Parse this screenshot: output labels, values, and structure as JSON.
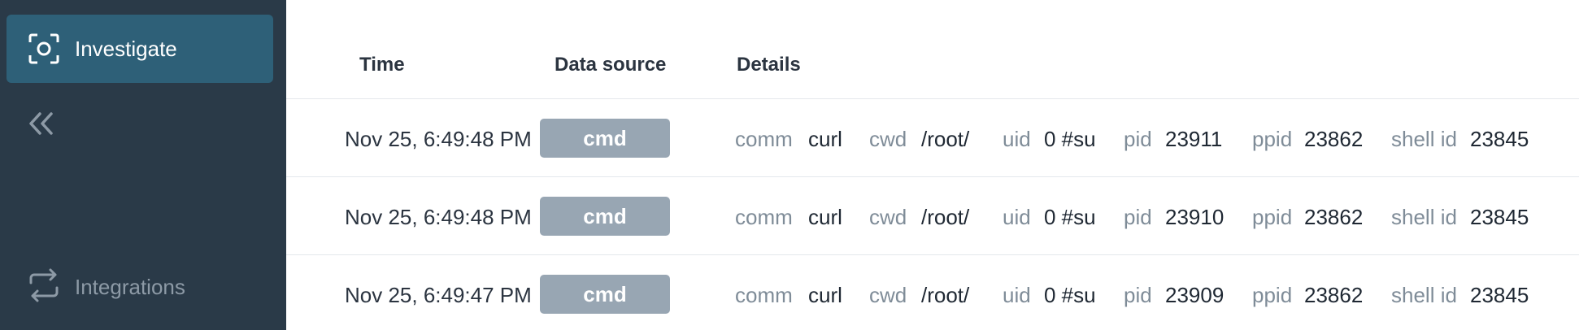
{
  "sidebar": {
    "active_item": {
      "label": "Investigate",
      "icon": "investigate-icon"
    },
    "collapse_icon": "double-chevron-left-icon",
    "bottom_item": {
      "label": "Integrations",
      "icon": "integrations-icon"
    }
  },
  "table": {
    "headers": {
      "time": "Time",
      "data_source": "Data source",
      "details": "Details"
    },
    "rows": [
      {
        "time": "Nov 25, 6:49:48 PM",
        "source": "cmd",
        "comm_k": "comm",
        "comm": "curl",
        "cwd_k": "cwd",
        "cwd": "/root/",
        "uid_k": "uid",
        "uid": "0 #su",
        "pid_k": "pid",
        "pid": "23911",
        "ppid_k": "ppid",
        "ppid": "23862",
        "shell_k": "shell id",
        "shell": "23845"
      },
      {
        "time": "Nov 25, 6:49:48 PM",
        "source": "cmd",
        "comm_k": "comm",
        "comm": "curl",
        "cwd_k": "cwd",
        "cwd": "/root/",
        "uid_k": "uid",
        "uid": "0 #su",
        "pid_k": "pid",
        "pid": "23910",
        "ppid_k": "ppid",
        "ppid": "23862",
        "shell_k": "shell id",
        "shell": "23845"
      },
      {
        "time": "Nov 25, 6:49:47 PM",
        "source": "cmd",
        "comm_k": "comm",
        "comm": "curl",
        "cwd_k": "cwd",
        "cwd": "/root/",
        "uid_k": "uid",
        "uid": "0 #su",
        "pid_k": "pid",
        "pid": "23909",
        "ppid_k": "ppid",
        "ppid": "23862",
        "shell_k": "shell id",
        "shell": "23845"
      }
    ]
  },
  "colors": {
    "sidebar": "#2a3a48",
    "active": "#2e6078",
    "badge": "#98a6b3"
  }
}
